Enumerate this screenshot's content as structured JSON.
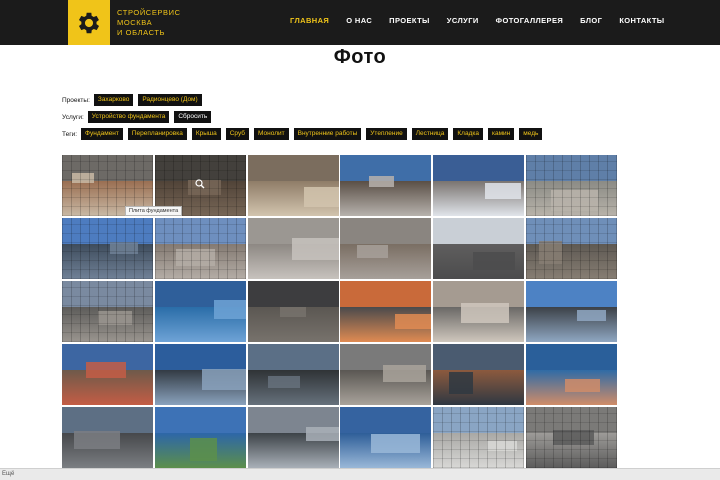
{
  "header": {
    "brand_lines": [
      "СТРОЙСЕРВИС",
      "МОСКВА",
      "И ОБЛАСТЬ"
    ],
    "logo_icon": "gear-icon",
    "nav": [
      {
        "label": "ГЛАВНАЯ",
        "active": true
      },
      {
        "label": "О НАС",
        "active": false
      },
      {
        "label": "ПРОЕКТЫ",
        "active": false
      },
      {
        "label": "УСЛУГИ",
        "active": false
      },
      {
        "label": "ФОТОГАЛЛЕРЕЯ",
        "active": false
      },
      {
        "label": "БЛОГ",
        "active": false
      },
      {
        "label": "КОНТАКТЫ",
        "active": false
      }
    ]
  },
  "page": {
    "title": "Фото"
  },
  "filters": {
    "projects": {
      "label": "Проекты:",
      "chips": [
        "Захарково",
        "Радионцево (Дом)"
      ]
    },
    "services": {
      "label": "Услуги:",
      "chips": [
        "Устройство фундамента",
        "Сбросить"
      ]
    },
    "tags": {
      "label": "Теги:",
      "chips": [
        "Фундамент",
        "Перепланировка",
        "Крыша",
        "Сруб",
        "Монолит",
        "Внутренние работы",
        "Утепление",
        "Лестница",
        "Кладка",
        "камин",
        "медь"
      ]
    }
  },
  "gallery": {
    "tooltip": "Плита фундамента",
    "hover_icon": "zoom-icon",
    "tiles": [
      {
        "sky": "#6d6a66",
        "ground": "#9a6f52",
        "accent": "#c9b9a5",
        "grid": true
      },
      {
        "sky": "#5a5650",
        "ground": "#6c5a4b",
        "accent": "#a08a75",
        "grid": true,
        "hover": true
      },
      {
        "sky": "#7b6d5e",
        "ground": "#8f7d68",
        "accent": "#d2c4ae",
        "grid": false
      },
      {
        "sky": "#3f6ea8",
        "ground": "#5a4f46",
        "accent": "#b7b2ad",
        "grid": false
      },
      {
        "sky": "#3a5e95",
        "ground": "#7a7470",
        "accent": "#e0e4ea",
        "grid": false
      },
      {
        "sky": "#5f7fa8",
        "ground": "#8b8b85",
        "accent": "#b8b3aa",
        "grid": true
      },
      {
        "sky": "#4d7cc0",
        "ground": "#3e4c5c",
        "accent": "#708197",
        "grid": true
      },
      {
        "sky": "#6e8fbf",
        "ground": "#847a72",
        "accent": "#b4ada6",
        "grid": true
      },
      {
        "sky": "#9b9792",
        "ground": "#8d8883",
        "accent": "#c7c2bd",
        "grid": false
      },
      {
        "sky": "#8a8580",
        "ground": "#7a6e63",
        "accent": "#a7a09a",
        "grid": false
      },
      {
        "sky": "#c9cfd6",
        "ground": "#5f5e5e",
        "accent": "#4c4c4d",
        "grid": false
      },
      {
        "sky": "#6f8fb9",
        "ground": "#5e5953",
        "accent": "#877e73",
        "grid": true
      },
      {
        "sky": "#7a8aa0",
        "ground": "#5d5c5a",
        "accent": "#9a958f",
        "grid": true
      },
      {
        "sky": "#2f5f9a",
        "ground": "#2a6da8",
        "accent": "#6fa3d6",
        "grid": false
      },
      {
        "sky": "#3d3d3f",
        "ground": "#5b5752",
        "accent": "#77726c",
        "grid": false
      },
      {
        "sky": "#c96a3a",
        "ground": "#4a4a4c",
        "accent": "#e08b52",
        "grid": false
      },
      {
        "sky": "#a59b91",
        "ground": "#6a6866",
        "accent": "#cfc7bd",
        "grid": false
      },
      {
        "sky": "#4d82c4",
        "ground": "#3c4147",
        "accent": "#8fa7c2",
        "grid": false
      },
      {
        "sky": "#3d66a2",
        "ground": "#6e5a4a",
        "accent": "#c45d45",
        "grid": false
      },
      {
        "sky": "#2c5d9c",
        "ground": "#333b44",
        "accent": "#8aa2bd",
        "grid": false
      },
      {
        "sky": "#5b6f86",
        "ground": "#2f3336",
        "accent": "#66717c",
        "grid": false
      },
      {
        "sky": "#7a7a7a",
        "ground": "#5a5753",
        "accent": "#a9a39b",
        "grid": false
      },
      {
        "sky": "#4a5b70",
        "ground": "#8c5a3e",
        "accent": "#2f3842",
        "grid": false
      },
      {
        "sky": "#2a5f9a",
        "ground": "#2f6ba6",
        "accent": "#d08c68",
        "grid": false
      },
      {
        "sky": "#5d6f84",
        "ground": "#46484b",
        "accent": "#7b7e82",
        "grid": false
      },
      {
        "sky": "#3d72b6",
        "ground": "#2d66a8",
        "accent": "#5c8f4b",
        "grid": false
      },
      {
        "sky": "#7d8590",
        "ground": "#3d4348",
        "accent": "#a9b0b8",
        "grid": false
      },
      {
        "sky": "#3563a0",
        "ground": "#2e5e98",
        "accent": "#9ab8d8",
        "grid": false
      },
      {
        "sky": "#8aa5c4",
        "ground": "#a9a8a5",
        "accent": "#d8d8d6",
        "grid": true
      },
      {
        "sky": "#7b7a78",
        "ground": "#9d9b98",
        "accent": "#5b5b5b",
        "grid": true
      }
    ]
  },
  "statusbar": {
    "text": "Ещё"
  }
}
